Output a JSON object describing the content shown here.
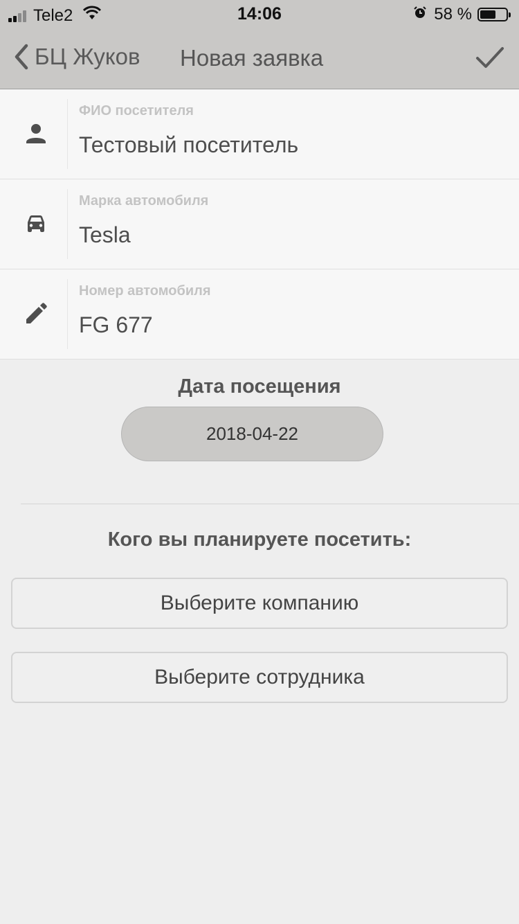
{
  "status_bar": {
    "carrier": "Tele2",
    "time": "14:06",
    "battery": "58 %",
    "battery_level_percent": 58,
    "icons": [
      "signal-icon",
      "wifi-icon",
      "alarm-icon",
      "battery-icon"
    ]
  },
  "nav": {
    "back_label": "БЦ Жуков",
    "title": "Новая заявка",
    "done_icon": "checkmark-icon"
  },
  "form": {
    "visitor": {
      "label": "ФИО посетителя",
      "value": "Тестовый посетитель",
      "icon": "person-icon"
    },
    "car_brand": {
      "label": "Марка автомобиля",
      "value": "Tesla",
      "icon": "car-icon"
    },
    "car_number": {
      "label": "Номер автомобиля",
      "value": "FG 677",
      "icon": "pencil-icon"
    }
  },
  "visit_date": {
    "title": "Дата посещения",
    "value": "2018-04-22"
  },
  "visit_target": {
    "title": "Кого вы планируете посетить:",
    "company_button": "Выберите компанию",
    "employee_button": "Выберите сотрудника"
  },
  "colors": {
    "bar_background": "#c9c8c6",
    "page_background": "#eeeeee",
    "row_background": "#f7f7f7",
    "pill_background": "#cac9c7"
  }
}
